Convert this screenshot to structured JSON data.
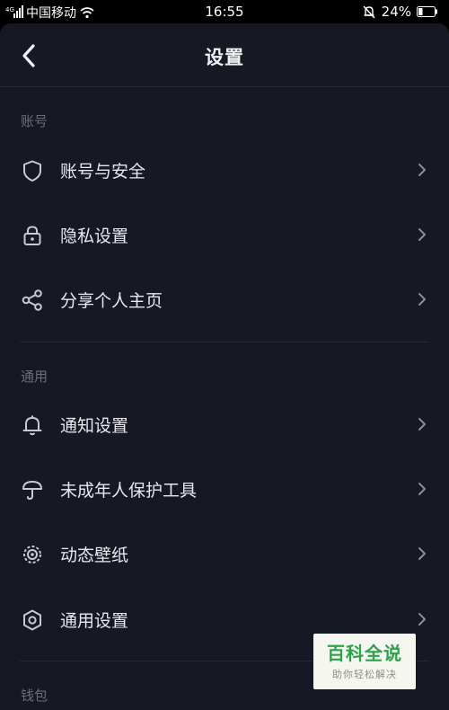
{
  "status_bar": {
    "carrier": "中国移动",
    "time": "16:55",
    "battery": "24%"
  },
  "header": {
    "title": "设置"
  },
  "sections": [
    {
      "title": "账号",
      "items": [
        {
          "label": "账号与安全",
          "icon": "shield-icon"
        },
        {
          "label": "隐私设置",
          "icon": "lock-icon"
        },
        {
          "label": "分享个人主页",
          "icon": "share-icon"
        }
      ]
    },
    {
      "title": "通用",
      "items": [
        {
          "label": "通知设置",
          "icon": "bell-icon"
        },
        {
          "label": "未成年人保护工具",
          "icon": "umbrella-icon"
        },
        {
          "label": "动态壁纸",
          "icon": "wallpaper-icon"
        },
        {
          "label": "通用设置",
          "icon": "hexagon-settings-icon"
        }
      ]
    },
    {
      "title": "钱包",
      "items": []
    }
  ],
  "watermark": {
    "title": "百科全说",
    "subtitle": "助你轻松解决"
  },
  "colors": {
    "background": "#161823",
    "status_bar": "#000000",
    "text": "#e8e8ec",
    "section_header": "#6b6d78",
    "divider": "#262834",
    "watermark_green": "#2ea24a"
  }
}
